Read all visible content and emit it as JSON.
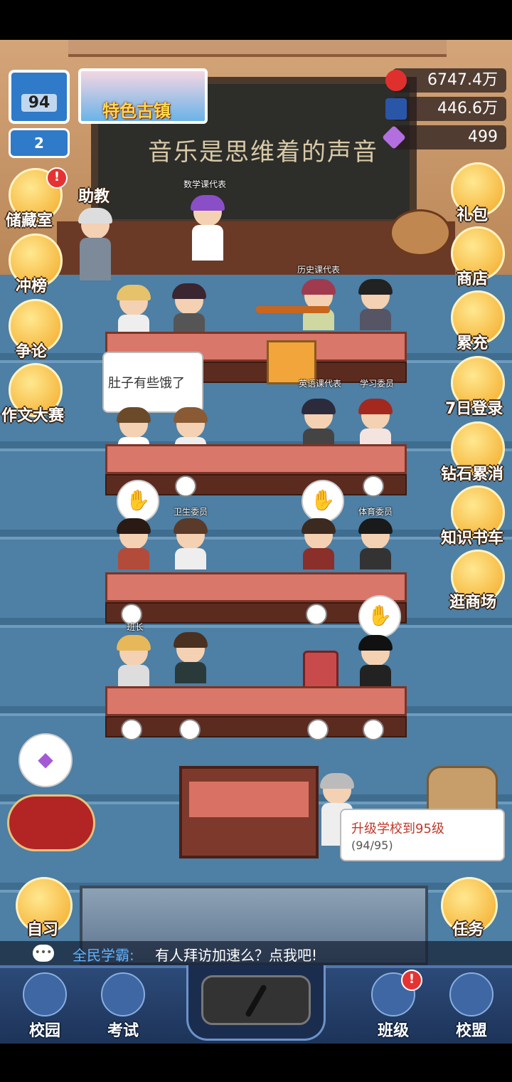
{
  "header": {
    "school_level": "94",
    "rank_level": "2",
    "banner_label": "特色古镇"
  },
  "stats": {
    "hearts": "6747.4万",
    "knowledge": "446.6万",
    "diamonds": "499"
  },
  "blackboard": {
    "text": "音乐是思维着的声音"
  },
  "left_menu": [
    {
      "label": "助教"
    },
    {
      "label": "储藏室"
    },
    {
      "label": "冲榜"
    },
    {
      "label": "争论"
    },
    {
      "label": "作文大赛"
    }
  ],
  "right_menu": [
    {
      "label": "礼包"
    },
    {
      "label": "商店"
    },
    {
      "label": "累充"
    },
    {
      "label": "7日登录"
    },
    {
      "label": "钻石累消"
    },
    {
      "label": "知识书车"
    },
    {
      "label": "逛商场"
    }
  ],
  "roles": {
    "math": "数学课代表",
    "history": "历史课代表",
    "english": "英语课代表",
    "study": "学习委员",
    "health": "卫生委员",
    "sports": "体育委员",
    "monitor": "班长"
  },
  "speech_bubble": "肚子有些饿了",
  "task_bubble": {
    "title": "升级学校到95级",
    "progress": "(94/95)"
  },
  "bottom_actions": {
    "self_study": "自习",
    "tasks": "任务"
  },
  "ticker": {
    "sender": "全民学霸:",
    "message": "有人拜访加速么？点我吧!"
  },
  "nav": [
    {
      "label": "校园"
    },
    {
      "label": "考试"
    },
    {
      "label": "班级"
    },
    {
      "label": "校盟"
    }
  ],
  "colors": {
    "floor": "#3f6f92",
    "desk": "#d9776b",
    "nav": "#2c4a78",
    "accent_gold": "#f3a825",
    "badge_red": "#e53333"
  }
}
